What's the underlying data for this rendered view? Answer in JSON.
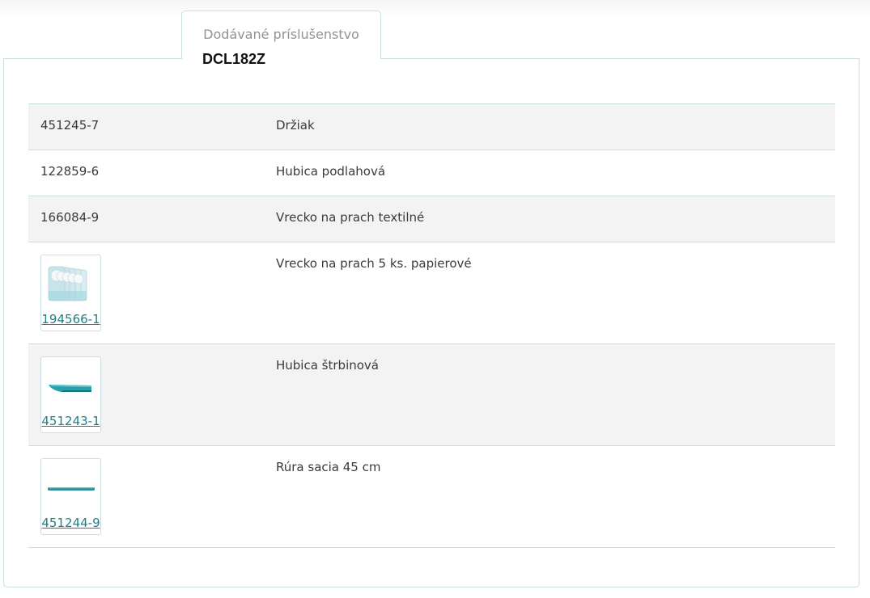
{
  "tab": {
    "label": "Dodávané príslušenstvo"
  },
  "model": "DCL182Z",
  "accessories": [
    {
      "code": "451245-7",
      "name": "Držiak",
      "has_image": false,
      "icon": ""
    },
    {
      "code": "122859-6",
      "name": "Hubica podlahová",
      "has_image": false,
      "icon": ""
    },
    {
      "code": "166084-9",
      "name": "Vrecko na prach textilné",
      "has_image": false,
      "icon": ""
    },
    {
      "code": "194566-1",
      "name": "Vrecko na prach 5 ks. papierové",
      "has_image": true,
      "icon": "paper-dust-bags-icon"
    },
    {
      "code": "451243-1",
      "name": "Hubica štrbinová",
      "has_image": true,
      "icon": "crevice-nozzle-icon"
    },
    {
      "code": "451244-9",
      "name": "Rúra sacia 45 cm",
      "has_image": true,
      "icon": "suction-tube-icon"
    }
  ],
  "colors": {
    "border": "#c9dfe1",
    "link": "#1f7f86",
    "row_shade": "#f3f3f3",
    "accent_teal": "#2a9fa6"
  }
}
